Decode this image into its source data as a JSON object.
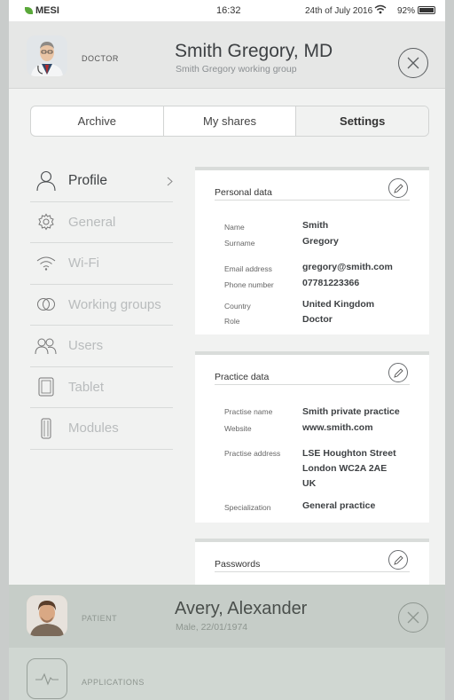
{
  "status_bar": {
    "carrier": "MESI",
    "time": "16:32",
    "date": "24th of July 2016",
    "battery": "92%"
  },
  "doctor": {
    "role": "DOCTOR",
    "name": "Smith Gregory, MD",
    "group": "Smith Gregory working group"
  },
  "tabs": [
    {
      "label": "Archive"
    },
    {
      "label": "My shares"
    },
    {
      "label": "Settings"
    }
  ],
  "sidebar": {
    "items": [
      {
        "label": "Profile",
        "icon": "person-icon"
      },
      {
        "label": "General",
        "icon": "gear-icon"
      },
      {
        "label": "Wi-Fi",
        "icon": "wifi-icon"
      },
      {
        "label": "Working groups",
        "icon": "working-groups-icon"
      },
      {
        "label": "Users",
        "icon": "users-icon"
      },
      {
        "label": "Tablet",
        "icon": "tablet-icon"
      },
      {
        "label": "Modules",
        "icon": "module-icon"
      }
    ]
  },
  "personal_data": {
    "title": "Personal data",
    "name_label": "Name",
    "name": "Smith",
    "surname_label": "Surname",
    "surname": "Gregory",
    "email_label": "Email address",
    "email": "gregory@smith.com",
    "phone_label": "Phone number",
    "phone": "07781223366",
    "country_label": "Country",
    "country": "United Kingdom",
    "role_label": "Role",
    "role": "Doctor"
  },
  "practice_data": {
    "title": "Practice data",
    "practise_name_label": "Practise name",
    "practise_name": "Smith private practice",
    "website_label": "Website",
    "website": "www.smith.com",
    "address_label": "Practise address",
    "address_line1": "LSE Houghton Street",
    "address_line2": "London WC2A 2AE",
    "address_line3": "UK",
    "specialization_label": "Specialization",
    "specialization": "General practice"
  },
  "passwords": {
    "title": "Passwords"
  },
  "patient": {
    "role": "PATIENT",
    "name": "Avery, Alexander",
    "details": "Male, 22/01/1974"
  },
  "applications": {
    "label": "APPLICATIONS"
  }
}
